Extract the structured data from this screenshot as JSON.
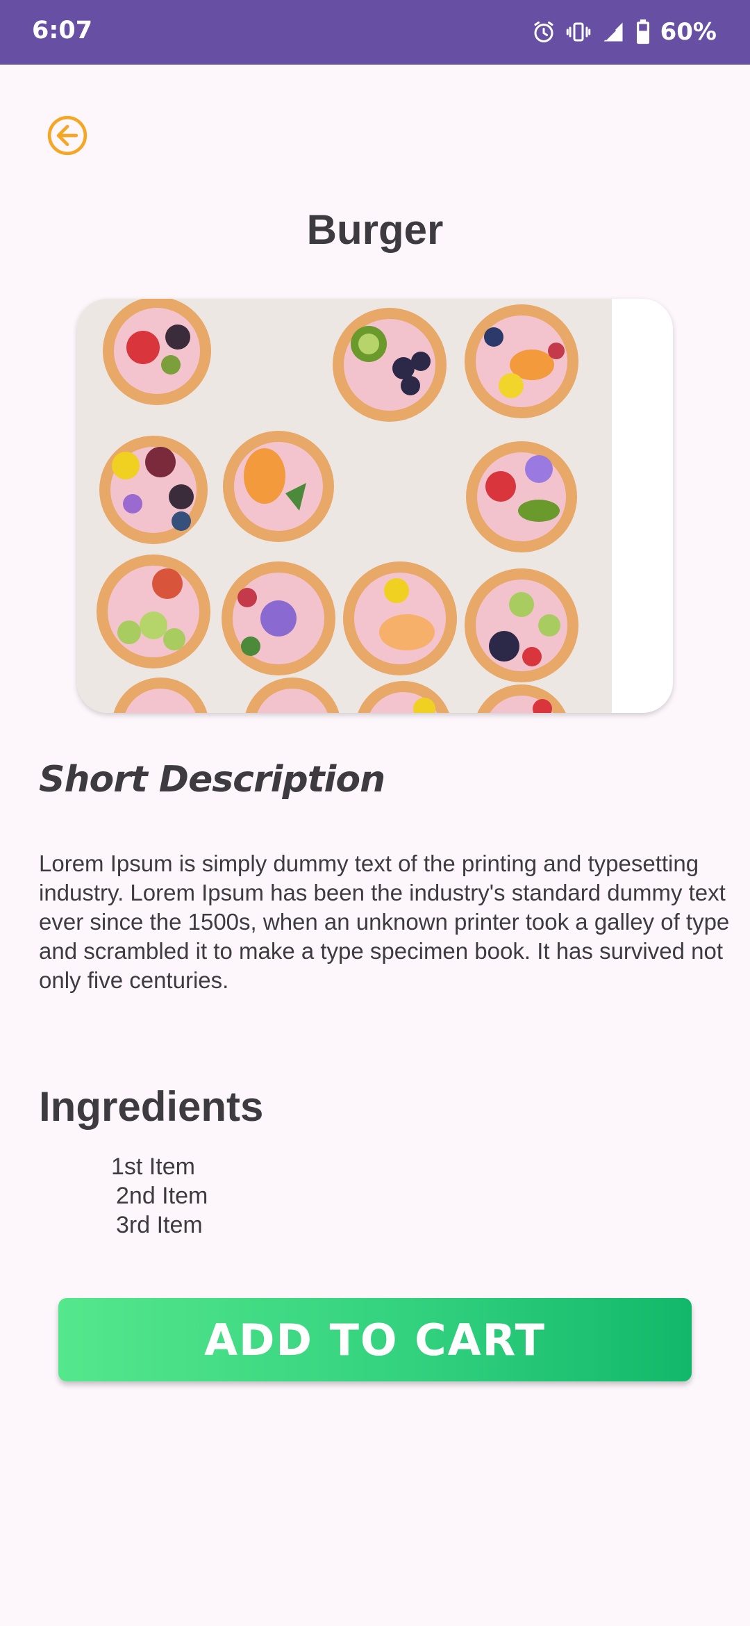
{
  "status_bar": {
    "time": "6:07",
    "battery": "60%",
    "icons": [
      "alarm-icon",
      "vibrate-icon",
      "cell-signal-icon",
      "battery-icon"
    ],
    "background": "#6750a4"
  },
  "header": {
    "back_icon": "arrow-left-circle-icon",
    "back_color": "#f5a623",
    "title": "Burger"
  },
  "product": {
    "image": "food-photo"
  },
  "short_description": {
    "heading": "Short Description",
    "text": "Lorem Ipsum is simply dummy text of the printing and typesetting industry. Lorem Ipsum has been the industry's standard dummy text ever since the 1500s, when an unknown printer took a galley of type and scrambled it to make a type specimen book. It has survived not only five centuries."
  },
  "ingredients": {
    "heading": "Ingredients",
    "items": [
      "1st Item",
      "2nd Item",
      "3rd Item"
    ]
  },
  "cart_button": {
    "label": "ADD TO CART",
    "color_start": "#55e78c",
    "color_end": "#12b86a"
  }
}
